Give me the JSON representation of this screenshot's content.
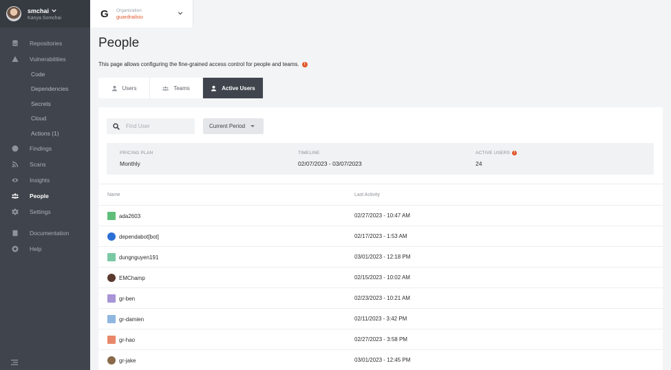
{
  "user": {
    "username": "smchai",
    "full_name": "Kanya Somchai"
  },
  "org": {
    "label": "Organization",
    "name": "guardrailsio",
    "logo": "G"
  },
  "sidebar": {
    "items": [
      {
        "label": "Repositories",
        "icon": "database-icon"
      },
      {
        "label": "Vulnerabilities",
        "icon": "warning-icon"
      }
    ],
    "sub_items": [
      {
        "label": "Code"
      },
      {
        "label": "Dependencies"
      },
      {
        "label": "Secrets"
      },
      {
        "label": "Cloud"
      },
      {
        "label": "Actions (1)"
      }
    ],
    "items2": [
      {
        "label": "Findings",
        "icon": "info-circle-icon"
      },
      {
        "label": "Scans",
        "icon": "rss-icon"
      },
      {
        "label": "Insights",
        "icon": "eye-icon"
      },
      {
        "label": "People",
        "icon": "people-icon",
        "active": true
      },
      {
        "label": "Settings",
        "icon": "gear-icon"
      }
    ],
    "items3": [
      {
        "label": "Documentation",
        "icon": "book-icon"
      },
      {
        "label": "Help",
        "icon": "lifebuoy-icon"
      }
    ]
  },
  "page": {
    "title": "People",
    "description": "This page allows configuring the fine-grained access control for people and teams."
  },
  "tabs": [
    {
      "label": "Users",
      "icon": "user-icon"
    },
    {
      "label": "Teams",
      "icon": "team-icon"
    },
    {
      "label": "Active Users",
      "icon": "user-icon",
      "active": true
    }
  ],
  "search": {
    "placeholder": "Find User",
    "value": ""
  },
  "period_select": {
    "selected": "Current Period"
  },
  "stats": {
    "pricing_plan": {
      "label": "PRICING PLAN",
      "value": "Monthly"
    },
    "timeline": {
      "label": "TIMELINE",
      "value": "02/07/2023 - 03/07/2023"
    },
    "active_users": {
      "label": "ACTIVE USERS",
      "value": "24"
    }
  },
  "table": {
    "columns": [
      "Name",
      "Last Activity"
    ],
    "rows": [
      {
        "name": "ada2603",
        "last_activity": "02/27/2023 - 10:47 AM",
        "avatar_color": "#5fbf7a"
      },
      {
        "name": "dependabot[bot]",
        "last_activity": "02/17/2023 - 1:53 AM",
        "avatar_color": "#2b6fd6"
      },
      {
        "name": "dungnguyen191",
        "last_activity": "03/01/2023 - 12:18 PM",
        "avatar_color": "#7ac9a4"
      },
      {
        "name": "EMChamp",
        "last_activity": "02/15/2023 - 10:02 AM",
        "avatar_color": "#5a3a2e"
      },
      {
        "name": "gr-ben",
        "last_activity": "02/23/2023 - 10:21 AM",
        "avatar_color": "#a894d6"
      },
      {
        "name": "gr-damien",
        "last_activity": "02/11/2023 - 3:42 PM",
        "avatar_color": "#8fb7e0"
      },
      {
        "name": "gr-hao",
        "last_activity": "02/27/2023 - 3:58 PM",
        "avatar_color": "#e8876a"
      },
      {
        "name": "gr-jake",
        "last_activity": "03/01/2023 - 12:45 PM",
        "avatar_color": "#8a6a4a"
      }
    ]
  },
  "colors": {
    "accent": "#e0572b",
    "sidebar_bg": "#40454d",
    "active_tab_bg": "#40454d"
  }
}
